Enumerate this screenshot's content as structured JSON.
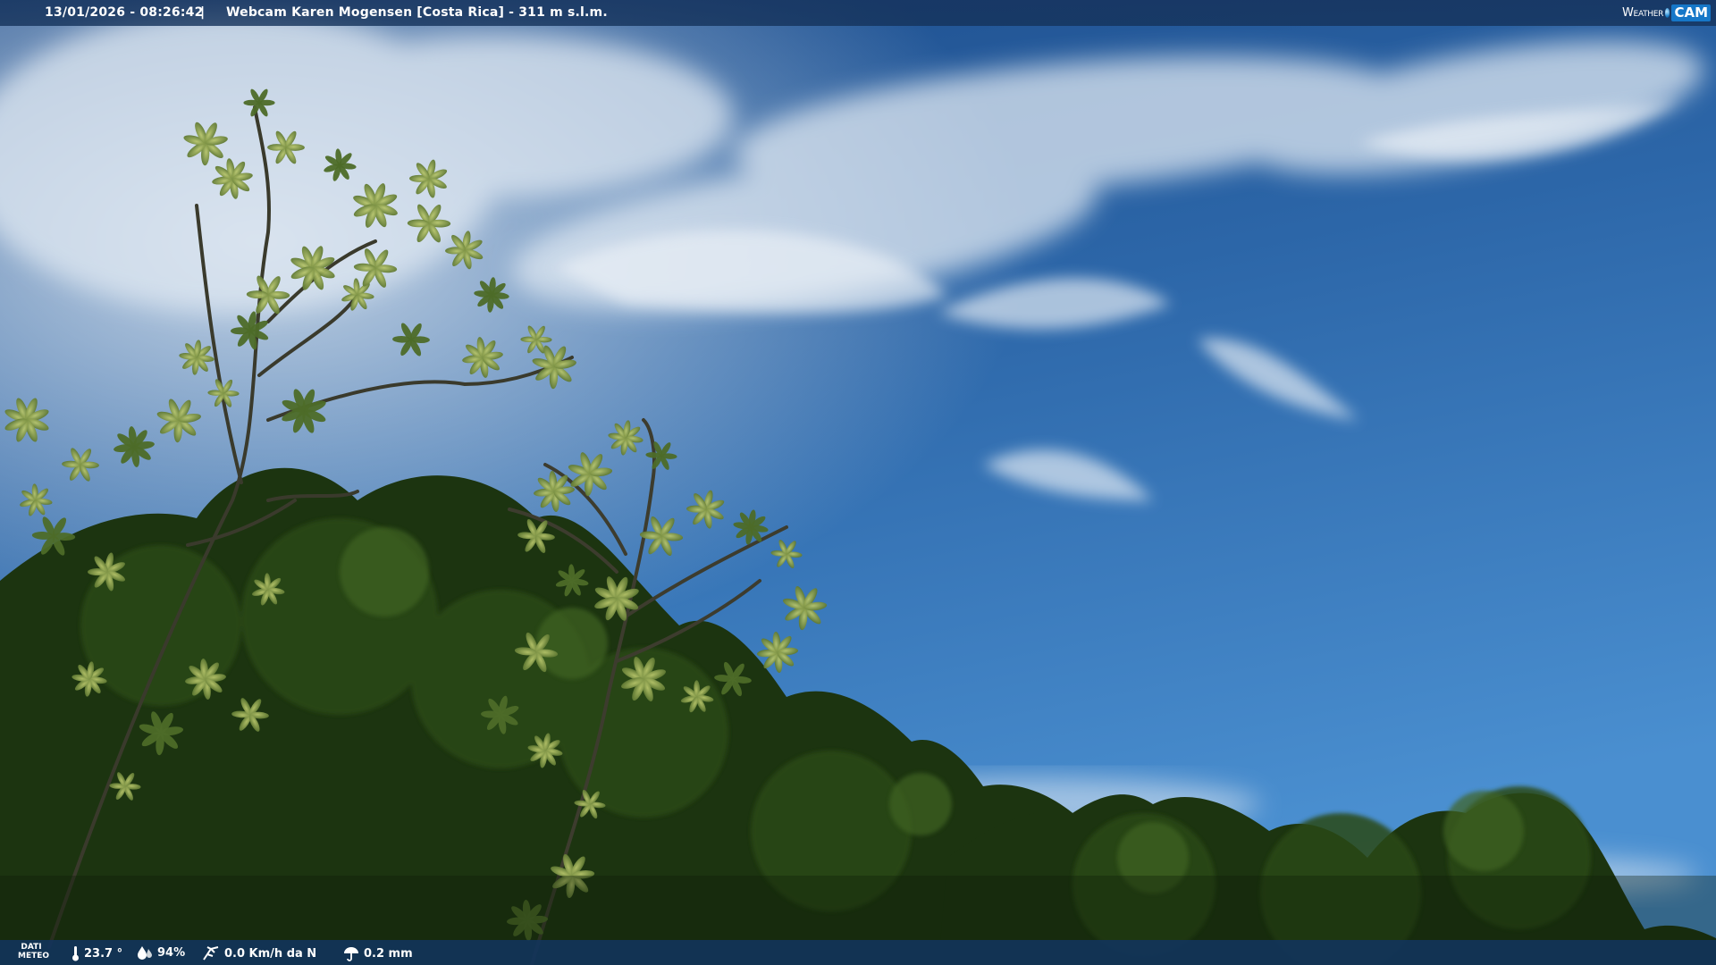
{
  "header": {
    "datetime": "13/01/2026 - 08:26:42",
    "separator": "|",
    "title": "Webcam Karen Mogensen [Costa Rica] - 311 m s.l.m."
  },
  "logo": {
    "word": "Weather",
    "cam": "CAM"
  },
  "meteo": {
    "label_line1": "DATI",
    "label_line2": "METEO",
    "temperature": "23.7 °",
    "humidity": "94%",
    "wind": "0.0 Km/h da N",
    "rain": "0.2 mm"
  },
  "icons": [
    "thermometer-icon",
    "humidity-drop-icon",
    "wind-icon",
    "rain-umbrella-icon",
    "weathercam-logo-icon"
  ],
  "colors": {
    "bar": "#16345f",
    "sky_top": "#1d4f8f",
    "sky_bottom": "#4a8fd0",
    "foliage": "#1f3a12"
  }
}
